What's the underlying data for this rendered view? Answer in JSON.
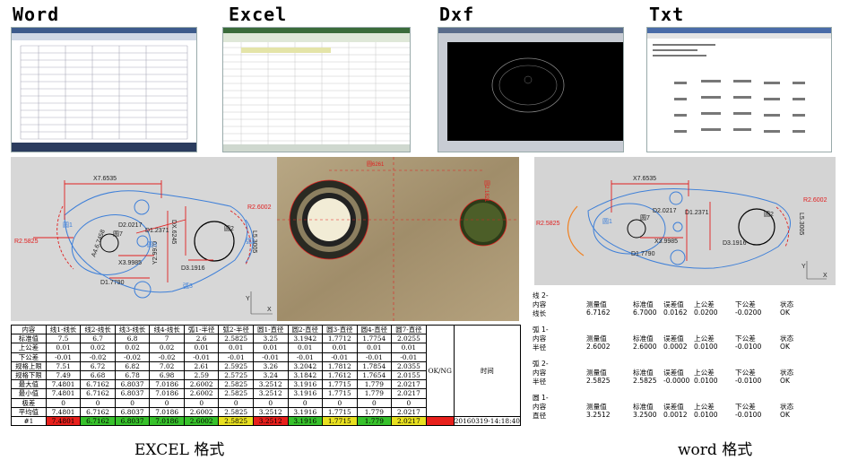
{
  "headings": {
    "word": "Word",
    "excel": "Excel",
    "dxf": "Dxf",
    "txt": "Txt"
  },
  "cad_left": {
    "labels": {
      "x7": "X7.6535",
      "d2": "D2.0217",
      "d1_2371": "D1.2371",
      "dx": "DX.6245",
      "r2_5825": "R2.5825",
      "r2_6002": "R2.6002",
      "l5": "L5.3005",
      "x3": "X3.9985",
      "y2": "Y2.9970",
      "a": "A4.6.7458",
      "d3": "D3.1916",
      "d1_7790": "D1.7790",
      "y": "Y",
      "x": "X",
      "c1": "圆1",
      "c2": "圆2",
      "c3": "圆3",
      "c7": "圆7",
      "s1": "弧1",
      "s3": "弧3"
    }
  },
  "cad_right": {
    "labels": {
      "x7": "X7.6535",
      "d2": "D2.0217",
      "d1_2371": "D1.2371",
      "r2_5825": "R2.5825",
      "r2_6002": "R2.6002",
      "x3": "X3.9985",
      "d3": "D3.1916",
      "d1_7790": "D1.7790",
      "l5": "L5.3005",
      "y": "Y",
      "x": "X",
      "c1": "圆1",
      "c2": "圆2",
      "c7": "圆7"
    }
  },
  "micro": {
    "labels": {
      "a": "圆6261",
      "b": "圆2.1821"
    }
  },
  "table": {
    "header": [
      "内容",
      "线1-线长",
      "线2-线长",
      "线3-线长",
      "线4-线长",
      "弧1-半径",
      "弧2-半径",
      "圆1-直径",
      "圆2-直径",
      "圆3-直径",
      "圆4-直径",
      "圆7-直径"
    ],
    "rows": [
      [
        "标准值",
        "7.5",
        "6.7",
        "6.8",
        "7",
        "2.6",
        "2.5825",
        "3.25",
        "3.1942",
        "1.7712",
        "1.7754",
        "2.0255"
      ],
      [
        "上公差",
        "0.01",
        "0.02",
        "0.02",
        "0.02",
        "0.01",
        "0.01",
        "0.01",
        "0.01",
        "0.01",
        "0.01",
        "0.01"
      ],
      [
        "下公差",
        "-0.01",
        "-0.02",
        "-0.02",
        "-0.02",
        "-0.01",
        "-0.01",
        "-0.01",
        "-0.01",
        "-0.01",
        "-0.01",
        "-0.01"
      ],
      [
        "规格上限",
        "7.51",
        "6.72",
        "6.82",
        "7.02",
        "2.61",
        "2.5925",
        "3.26",
        "3.2042",
        "1.7812",
        "1.7854",
        "2.0355"
      ],
      [
        "规格下限",
        "7.49",
        "6.68",
        "6.78",
        "6.98",
        "2.59",
        "2.5725",
        "3.24",
        "3.1842",
        "1.7612",
        "1.7654",
        "2.0155"
      ],
      [
        "最大值",
        "7.4801",
        "6.7162",
        "6.8037",
        "7.0186",
        "2.6002",
        "2.5825",
        "3.2512",
        "3.1916",
        "1.7715",
        "1.779",
        "2.0217"
      ],
      [
        "最小值",
        "7.4801",
        "6.7162",
        "6.8037",
        "7.0186",
        "2.6002",
        "2.5825",
        "3.2512",
        "3.1916",
        "1.7715",
        "1.779",
        "2.0217"
      ],
      [
        "极差",
        "0",
        "0",
        "0",
        "0",
        "0",
        "0",
        "0",
        "0",
        "0",
        "0",
        "0"
      ],
      [
        "平均值",
        "7.4801",
        "6.7162",
        "6.8037",
        "7.0186",
        "2.6002",
        "2.5825",
        "3.2512",
        "3.1916",
        "1.7715",
        "1.779",
        "2.0217"
      ]
    ],
    "last_row": [
      "#1",
      "7.4801",
      "6.7162",
      "6.8037",
      "7.0186",
      "2.6002",
      "2.5825",
      "3.2512",
      "3.1916",
      "1.7715",
      "1.779",
      "2.0217"
    ],
    "last_row_colors": [
      "#ffffff",
      "#e8201c",
      "#37c12b",
      "#37c12b",
      "#37c12b",
      "#37c12b",
      "#e8e020",
      "#e8201c",
      "#37c12b",
      "#e8e020",
      "#37c12b",
      "#e8e020"
    ],
    "ok_header": "OK/NG",
    "time_header": "时间",
    "time_value": "20160319-14:18:40",
    "ok_color": "#e8201c"
  },
  "captions": {
    "excel": "EXCEL 格式",
    "word": "word 格式"
  },
  "word_report": {
    "cols": [
      "测量值",
      "标准值",
      "误差值",
      "上公差",
      "下公差",
      "状态"
    ],
    "blocks": [
      {
        "title": "线 2-",
        "content": "内容",
        "name": "线长",
        "values": [
          "6.7162",
          "6.7000",
          "0.0162",
          "0.0200",
          "-0.0200",
          "OK"
        ]
      },
      {
        "title": "弧 1-",
        "content": "内容",
        "name": "半径",
        "values": [
          "2.6002",
          "2.6000",
          "0.0002",
          "0.0100",
          "-0.0100",
          "OK"
        ]
      },
      {
        "title": "弧 2-",
        "content": "内容",
        "name": "半径",
        "values": [
          "2.5825",
          "2.5825",
          "-0.0000",
          "0.0100",
          "-0.0100",
          "OK"
        ]
      },
      {
        "title": "圆 1-",
        "content": "内容",
        "name": "直径",
        "values": [
          "3.2512",
          "3.2500",
          "0.0012",
          "0.0100",
          "-0.0100",
          "OK"
        ]
      }
    ]
  }
}
